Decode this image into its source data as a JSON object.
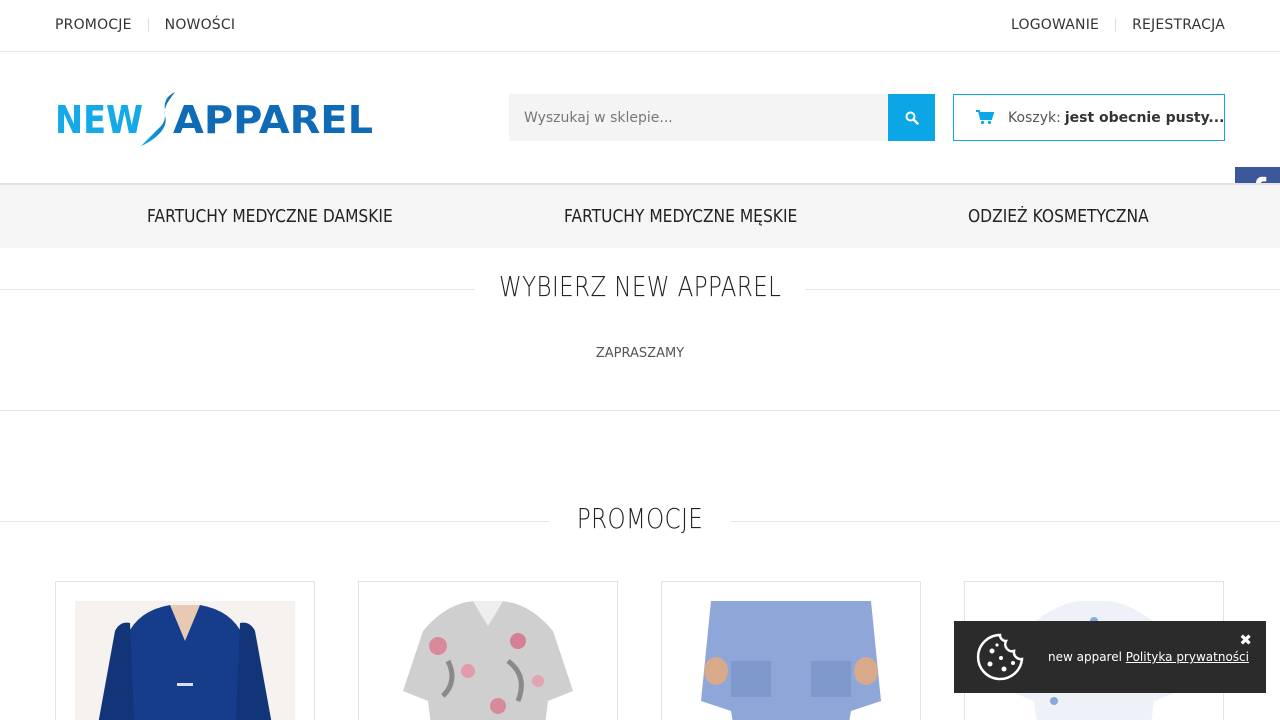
{
  "topbar": {
    "left_links": [
      "PROMOCJE",
      "NOWOŚCI"
    ],
    "right_links": [
      "LOGOWANIE",
      "REJESTRACJA"
    ]
  },
  "header": {
    "logo_text": "NEW APPAREL",
    "search_placeholder": "Wyszukaj w sklepie...",
    "cart_label": "Koszyk:",
    "cart_status": "jest obecnie pusty..."
  },
  "nav": {
    "items": [
      "FARTUCHY MEDYCZNE DAMSKIE",
      "FARTUCHY MEDYCZNE MĘSKIE",
      "ODZIEŻ KOSMETYCZNA"
    ]
  },
  "intro": {
    "title": "WYBIERZ NEW APPAREL",
    "subtitle": "ZAPRASZAMY"
  },
  "promotions": {
    "title": "PROMOCJE"
  },
  "cookie": {
    "text": "new apparel",
    "link": "Polityka prywatności",
    "close_symbol": "✖"
  },
  "colors": {
    "accent": "#0aa6e6",
    "logo_dark": "#0f6bb5",
    "facebook": "#3b5998",
    "cookie_bg": "#2b2b2b"
  },
  "icons": [
    "search-icon",
    "cart-icon",
    "facebook-icon",
    "cookie-icon",
    "close-icon"
  ]
}
